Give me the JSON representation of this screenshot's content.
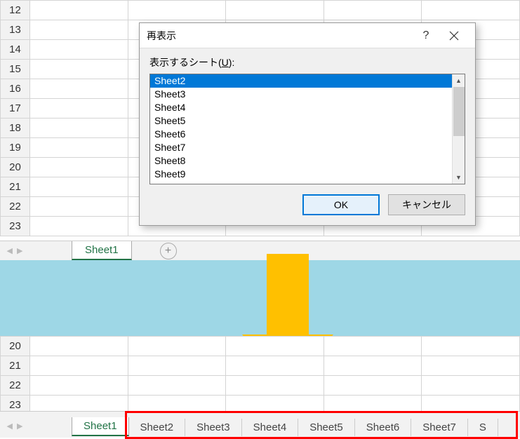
{
  "top_rows": [
    "12",
    "13",
    "14",
    "15",
    "16",
    "17",
    "18",
    "19",
    "20",
    "21",
    "22",
    "23"
  ],
  "top_tab": "Sheet1",
  "dialog": {
    "title": "再表示",
    "help": "?",
    "label_pre": "表示するシート(",
    "label_u": "U",
    "label_post": "):",
    "items": [
      "Sheet2",
      "Sheet3",
      "Sheet4",
      "Sheet5",
      "Sheet6",
      "Sheet7",
      "Sheet8",
      "Sheet9"
    ],
    "ok": "OK",
    "cancel": "キャンセル"
  },
  "bottom_rows": [
    "20",
    "21",
    "22",
    "23"
  ],
  "bottom_tabs": [
    "Sheet1",
    "Sheet2",
    "Sheet3",
    "Sheet4",
    "Sheet5",
    "Sheet6",
    "Sheet7",
    "S"
  ]
}
